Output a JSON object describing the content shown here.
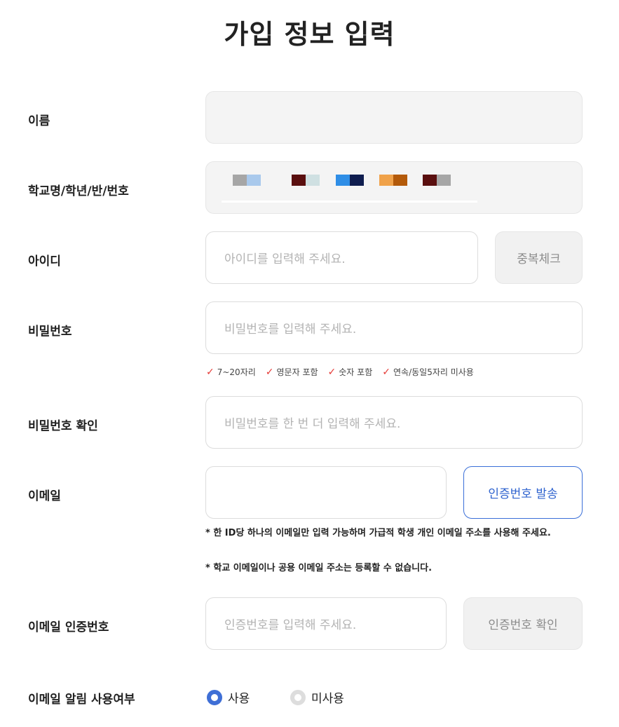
{
  "page": {
    "title": "가입 정보 입력"
  },
  "labels": {
    "name": "이름",
    "school": "학교명/학년/반/번호",
    "userid": "아이디",
    "password": "비밀번호",
    "password_confirm": "비밀번호 확인",
    "email": "이메일",
    "email_code": "이메일 인증번호",
    "email_notify": "이메일 알림 사용여부"
  },
  "fields": {
    "name_value": "",
    "userid_placeholder": "아이디를 입력해 주세요.",
    "password_placeholder": "비밀번호를 입력해 주세요.",
    "password_confirm_placeholder": "비밀번호를 한 번 더 입력해 주세요.",
    "email_value": "",
    "email_code_placeholder": "인증번호를 입력해 주세요."
  },
  "buttons": {
    "duplicate_check": "중복체크",
    "send_code": "인증번호 발송",
    "verify_code": "인증번호 확인"
  },
  "password_rules": [
    {
      "icon": "check-icon",
      "text": "7~20자리"
    },
    {
      "icon": "check-icon",
      "text": "영문자 포함"
    },
    {
      "icon": "check-icon",
      "text": "숫자 포함"
    },
    {
      "icon": "check-icon",
      "text": "연속/동일5자리 미사용"
    }
  ],
  "email_notice": {
    "line1": "* 한 ID당 하나의 이메일만 입력 가능하며 가급적 학생 개인 이메일 주소를 사용해 주세요.",
    "line2": "* 학교 이메일이나 공용 이메일 주소는 등록할 수 없습니다."
  },
  "email_notify_options": [
    {
      "label": "사용",
      "selected": true
    },
    {
      "label": "미사용",
      "selected": false
    }
  ],
  "colors": {
    "accent": "#3f6fd6",
    "check": "#e53935",
    "field_border": "#dcdcdc",
    "filled_bg": "#f4f4f4"
  }
}
